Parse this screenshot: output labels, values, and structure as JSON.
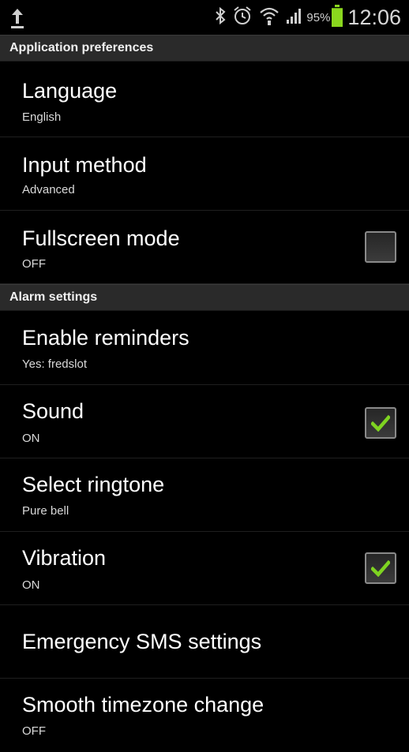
{
  "status_bar": {
    "icons": [
      "upload-icon",
      "bluetooth-icon",
      "alarm-icon",
      "wifi-icon",
      "signal-icon",
      "battery-icon"
    ],
    "battery_percent": "95%",
    "battery_level": 0.95,
    "time": "12:06",
    "accent_color": "#8ad71e"
  },
  "sections": {
    "app_prefs": {
      "header": "Application preferences"
    },
    "alarm": {
      "header": "Alarm settings"
    }
  },
  "prefs": {
    "language": {
      "title": "Language",
      "summary": "English"
    },
    "input_method": {
      "title": "Input method",
      "summary": "Advanced"
    },
    "fullscreen": {
      "title": "Fullscreen mode",
      "summary": "OFF",
      "checked": false
    },
    "reminders": {
      "title": "Enable reminders",
      "summary": "Yes: fredslot"
    },
    "sound": {
      "title": "Sound",
      "summary": "ON",
      "checked": true
    },
    "ringtone": {
      "title": "Select ringtone",
      "summary": "Pure bell"
    },
    "vibration": {
      "title": "Vibration",
      "summary": "ON",
      "checked": true
    },
    "emergency_sms": {
      "title": "Emergency SMS settings"
    },
    "timezone": {
      "title": "Smooth timezone change",
      "summary": "OFF"
    }
  },
  "colors": {
    "check_color": "#7ed321",
    "section_bg": "#2a2a2a"
  }
}
